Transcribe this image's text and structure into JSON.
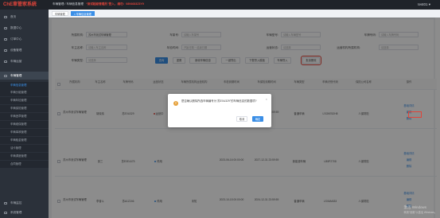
{
  "app": {
    "logo": "ChE車管家系統",
    "user": "test01 ▾"
  },
  "breadcrumb": {
    "path": "车辆管理  /  车辆信息管理",
    "warning": "“测试超級管理员”登入，請勿：0894683Z3Y9"
  },
  "tabs": [
    {
      "label": "车辆管理"
    },
    {
      "label": "× 车辆信息管理"
    }
  ],
  "sidebar": {
    "items": [
      {
        "label": "首页"
      },
      {
        "label": "数据中心"
      },
      {
        "label": "订单中心"
      },
      {
        "label": "设备管理"
      },
      {
        "label": "车辆运营"
      },
      {
        "label": "车辆管理"
      }
    ],
    "subitems": [
      {
        "label": "车辆信息管理"
      },
      {
        "label": "车辆分组管理"
      },
      {
        "label": "车辆年检管理"
      },
      {
        "label": "车辆保险管理"
      },
      {
        "label": "车辆违章管理"
      },
      {
        "label": "车辆维保管理"
      },
      {
        "label": "车辆事故管理"
      },
      {
        "label": "车辆租金管理"
      },
      {
        "label": "油卡管理"
      },
      {
        "label": "车辆调度管理"
      },
      {
        "label": "合同管理"
      }
    ],
    "bottom": [
      {
        "label": "车辆监控"
      },
      {
        "label": "系统管理"
      }
    ]
  },
  "filters": {
    "row1": [
      {
        "label": "所属机构:",
        "value": "苏州市测试车辆管理",
        "filled": true
      },
      {
        "label": "车架号:",
        "value": "请输入车架号",
        "filled": false
      },
      {
        "label": "车辆型号:",
        "value": "请输入车辆型号",
        "filled": false
      },
      {
        "label": "车牌号码:",
        "value": "请输入车牌号码",
        "filled": false
      }
    ],
    "row2": [
      {
        "label": "车主名称:",
        "value": "请输入车主名称",
        "filled": false
      },
      {
        "label": "年检时间:",
        "value": "开始日期  ~  结束日期",
        "filled": false
      },
      {
        "label": "运营状态:",
        "value": "请选择",
        "filled": false
      },
      {
        "label": "运营机构所属机构:",
        "value": "请选择",
        "filled": false
      }
    ],
    "row3": [
      {
        "label": "车辆类型:",
        "value": "请选择",
        "filled": false
      }
    ]
  },
  "actions": {
    "search": "查询",
    "reset": "重置",
    "add": "新增车辆信息",
    "export": "一键导出",
    "template": "下载导入模板",
    "import": "车辆导入",
    "batch_delete": "批量删除"
  },
  "table": {
    "headers": [
      "",
      "所属机构",
      "车主名称",
      "车牌号码",
      "运营状态",
      "车辆所属机构运营机构",
      "车检到期时间",
      "车保险到期时间",
      "车辆类型",
      "车辆识别代码",
      "保险公司名称",
      "操作"
    ],
    "rows": [
      {
        "org": "苏州市测试车辆管理",
        "owner": "胡晓伟",
        "plate": "苏E0U329",
        "status": "运营中",
        "status_color": "red",
        "op_org": "",
        "inspect": "2023-10-17 00:00:00",
        "insure": "2025-10-31 23:59:59",
        "type": "普通车辆",
        "vin": "LSGKE52H8",
        "company": "人保财险",
        "ops": [
          "基础详情",
          "编辑",
          "删除"
        ]
      },
      {
        "org": "苏州市测试车辆管理",
        "owner": "张三",
        "plate": "苏E0E4475",
        "status": "停用",
        "status_color": "blue",
        "op_org": "",
        "inspect": "2023-06-16 00:00:00",
        "insure": "2027-12-31 23:59:59",
        "type": "新能源车辆",
        "vin": "LB5P2708",
        "company": "人保财险",
        "ops": [
          "基础详情",
          "编辑",
          "删除"
        ]
      },
      {
        "org": "苏州市测试车辆管理",
        "owner": "李奋斗",
        "plate": "苏A1Z246",
        "status": "停用",
        "status_color": "blue",
        "op_org": "未知",
        "inspect": "2023-10-15 00:00:00",
        "insure": "2024-12-31 23:59:59",
        "type": "普通车辆",
        "vin": "LSVAM433",
        "company": "人保财险",
        "ops": [
          "基础详情",
          "编辑",
          "删除"
        ]
      }
    ]
  },
  "dialog": {
    "message": "是否确认删除所选车辆编号为\"苏E0U329\"的车辆信息的数据项?",
    "cancel": "取消",
    "confirm": "确定",
    "close": "×"
  },
  "watermark": {
    "line1": "激活 Windows",
    "line2": "转到“设置”以激活 Windows。"
  }
}
